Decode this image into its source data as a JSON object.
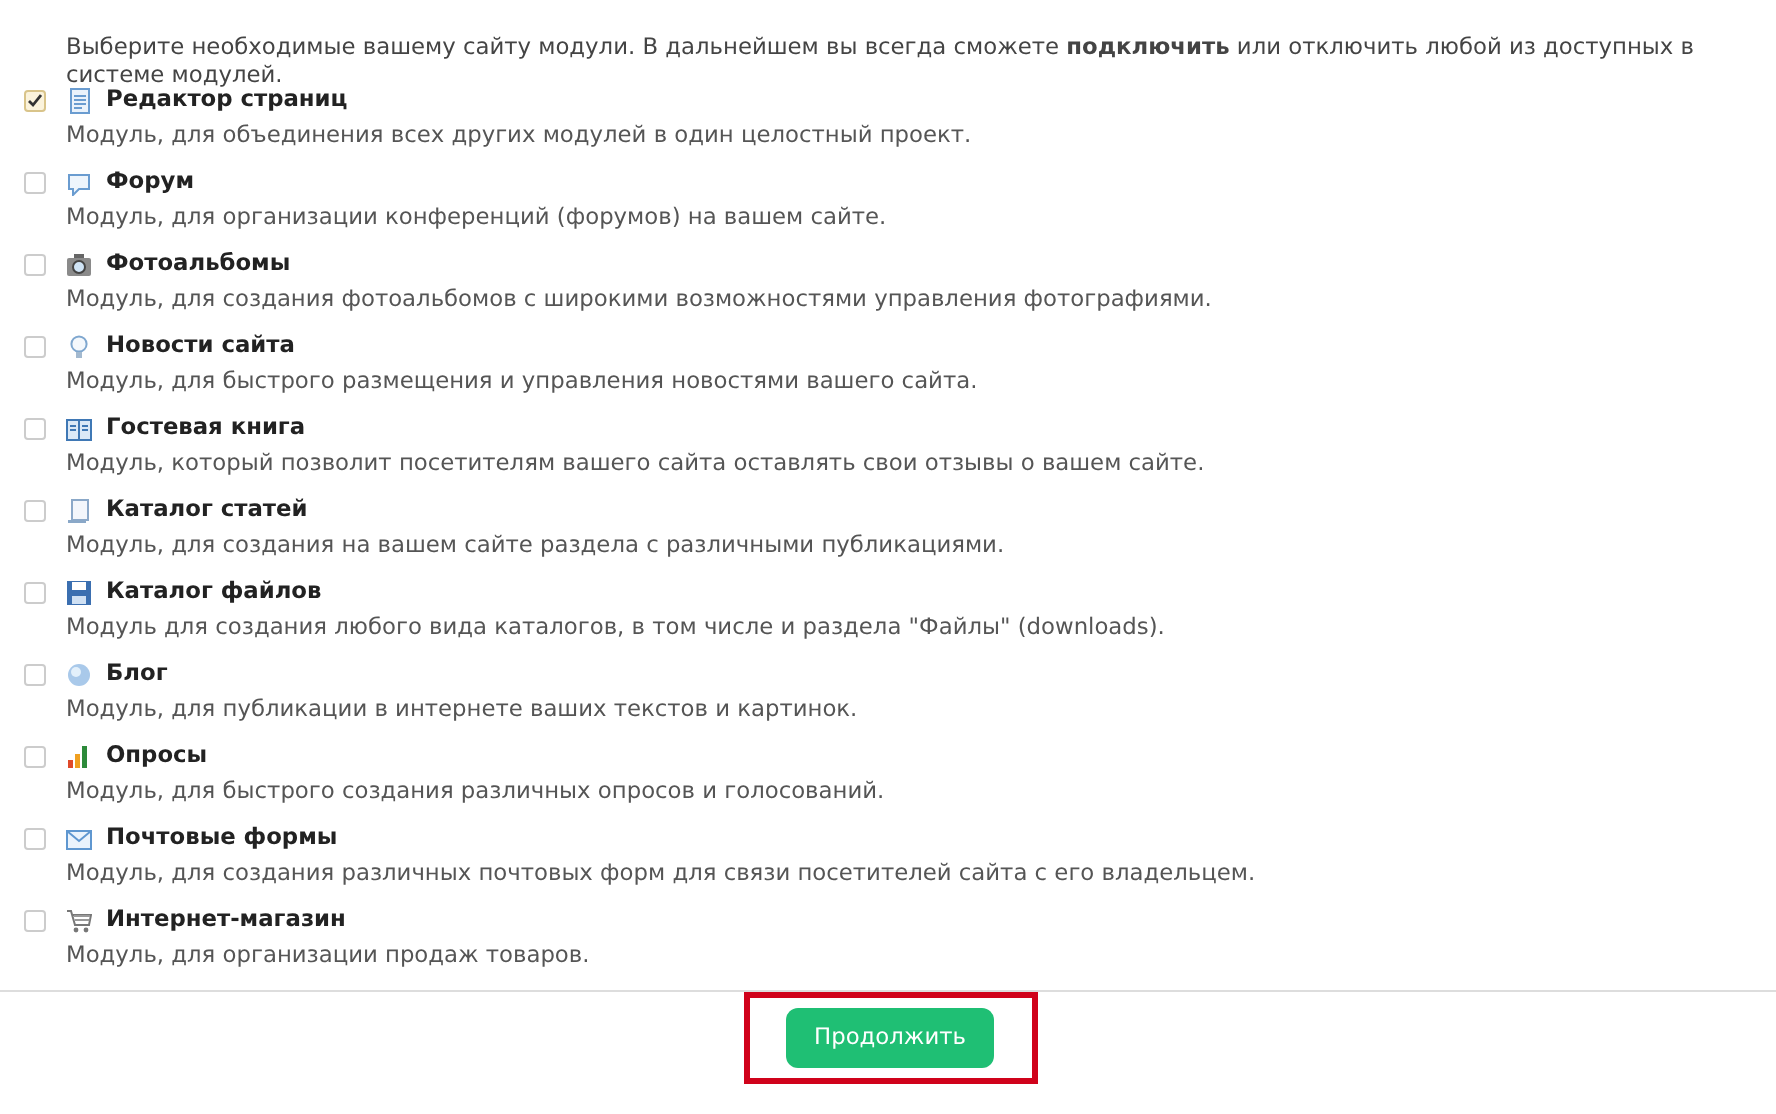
{
  "intro": "Выберите необходимые вашему сайту модули. В дальнейшем вы всегда сможете **подключить** или отключить любой из доступных в системе модулей.",
  "modules": [
    {
      "kind": "page",
      "title": "Редактор страниц",
      "description": "Модуль, для объединения всех других модулей в один целостный проект.",
      "checked": true
    },
    {
      "kind": "chat",
      "title": "Форум",
      "description": "Модуль, для организации конференций (форумов) на вашем сайте.",
      "checked": false
    },
    {
      "kind": "camera",
      "title": "Фотоальбомы",
      "description": "Модуль, для создания фотоальбомов с широкими возможностями управления фотографиями.",
      "checked": false
    },
    {
      "kind": "bulb",
      "title": "Новости сайта",
      "description": "Модуль, для быстрого размещения и управления новостями вашего сайта.",
      "checked": false
    },
    {
      "kind": "book",
      "title": "Гостевая книга",
      "description": "Модуль, который позволит посетителям вашего сайта оставлять свои отзывы о вашем сайте.",
      "checked": false
    },
    {
      "kind": "scroll",
      "title": "Каталог статей",
      "description": "Модуль, для создания на вашем сайте раздела с различными публикациями.",
      "checked": false
    },
    {
      "kind": "floppy",
      "title": "Каталог файлов",
      "description": "Модуль для создания любого вида каталогов, в том числе и раздела \"Файлы\" (downloads).",
      "checked": false
    },
    {
      "kind": "globe",
      "title": "Блог",
      "description": "Модуль, для публикации в интернете ваших текстов и картинок.",
      "checked": false
    },
    {
      "kind": "chart",
      "title": "Опросы",
      "description": "Модуль, для быстрого создания различных опросов и голосований.",
      "checked": false
    },
    {
      "kind": "envelope",
      "title": "Почтовые формы",
      "description": "Модуль, для создания различных почтовых форм для связи посетителей сайта с его владельцем.",
      "checked": false
    },
    {
      "kind": "cart",
      "title": "Интернет-магазин",
      "description": "Модуль, для организации продаж товаров.",
      "checked": false
    }
  ],
  "continue_button": "Продолжить"
}
